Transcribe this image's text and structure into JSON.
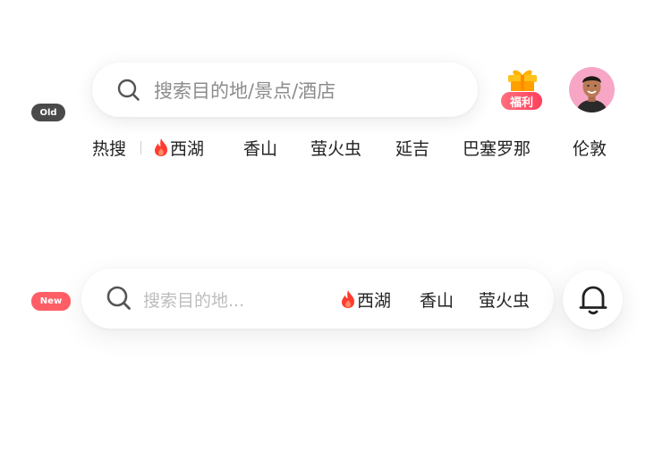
{
  "badges": {
    "old": "Old",
    "new": "New"
  },
  "old_bar": {
    "placeholder": "搜索目的地/景点/酒店",
    "welfare_label": "福利",
    "hot_label": "热搜",
    "hot_items": [
      "西湖",
      "香山",
      "萤火虫",
      "延吉",
      "巴塞罗那",
      "伦敦"
    ]
  },
  "new_bar": {
    "placeholder": "搜索目的地...",
    "hot_items": [
      "西湖",
      "香山",
      "萤火虫"
    ]
  },
  "icons": {
    "search": "search-icon",
    "fire": "fire-icon",
    "gift": "gift-icon",
    "bell": "bell-icon",
    "avatar": "user-avatar"
  },
  "colors": {
    "old_badge": "#4a4a4a",
    "new_badge": "#ff5e66",
    "fire": "#ff3b30",
    "welfare_tag": "#ff4f66",
    "avatar_bg": "#f7a7c5"
  }
}
